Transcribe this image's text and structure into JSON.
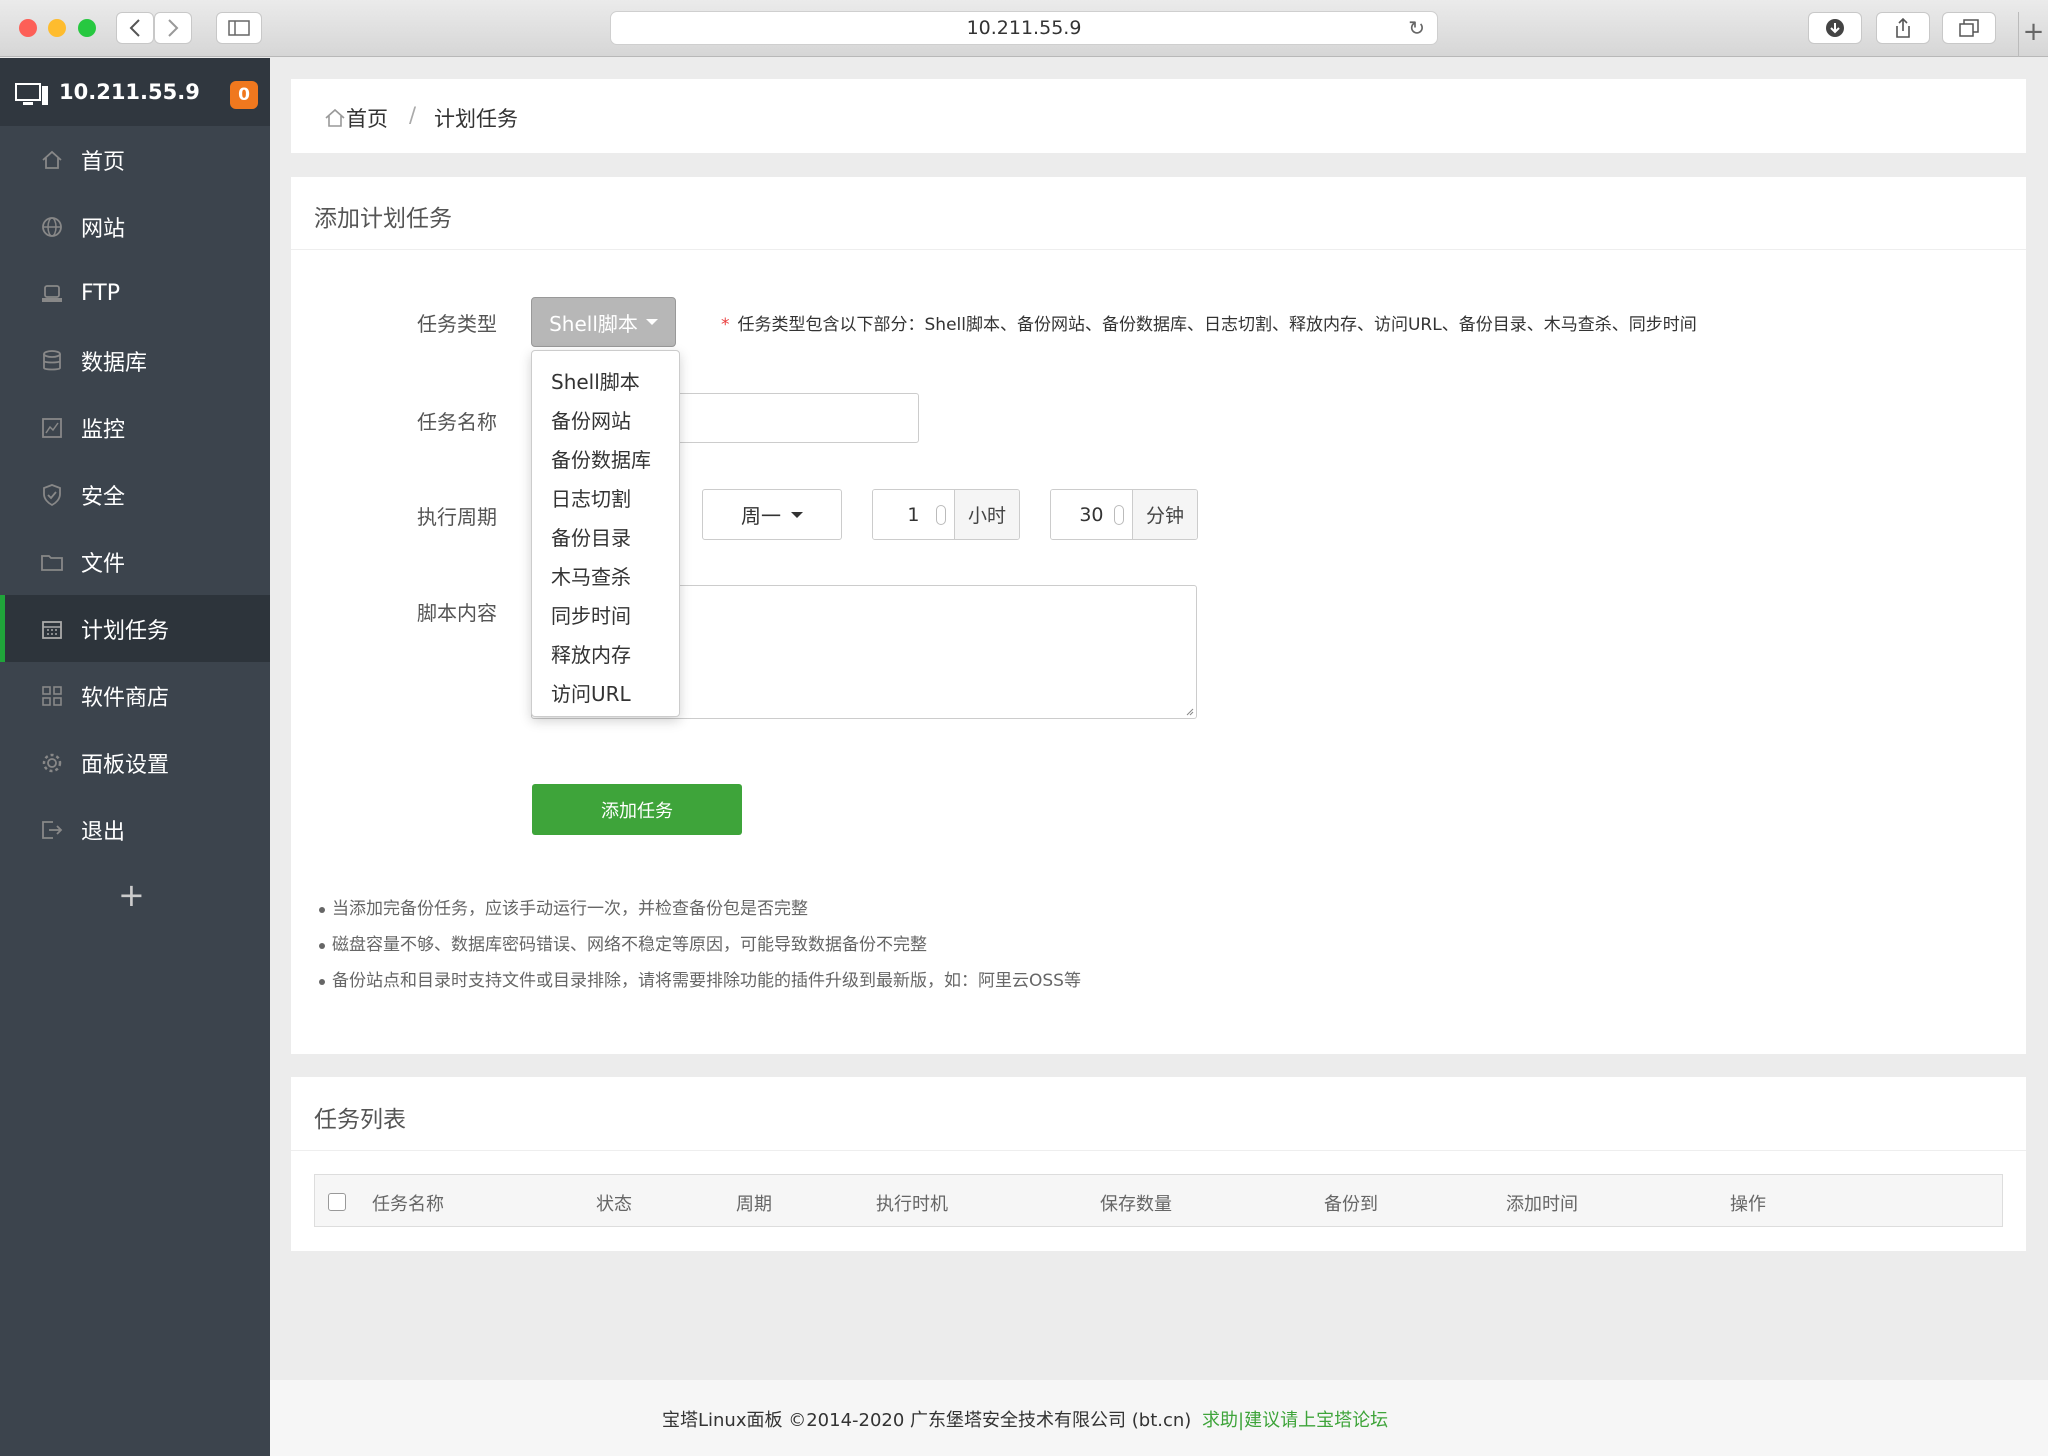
{
  "browser": {
    "url": "10.211.55.9"
  },
  "sidebar": {
    "server_ip": "10.211.55.9",
    "notification_count": "0",
    "items": [
      {
        "label": "首页",
        "icon": "home-icon"
      },
      {
        "label": "网站",
        "icon": "globe-icon"
      },
      {
        "label": "FTP",
        "icon": "ftp-icon"
      },
      {
        "label": "数据库",
        "icon": "database-icon"
      },
      {
        "label": "监控",
        "icon": "monitor-chart-icon"
      },
      {
        "label": "安全",
        "icon": "shield-icon"
      },
      {
        "label": "文件",
        "icon": "folder-icon"
      },
      {
        "label": "计划任务",
        "icon": "calendar-icon",
        "active": true
      },
      {
        "label": "软件商店",
        "icon": "grid-icon"
      },
      {
        "label": "面板设置",
        "icon": "gear-icon"
      },
      {
        "label": "退出",
        "icon": "logout-icon"
      }
    ],
    "add_label": "+"
  },
  "breadcrumb": {
    "home": "首页",
    "separator": "/",
    "current": "计划任务"
  },
  "add_task": {
    "title": "添加计划任务",
    "task_type_label": "任务类型",
    "task_type_value": "Shell脚本",
    "task_type_hint_star": "*",
    "task_type_hint": "任务类型包含以下部分：Shell脚本、备份网站、备份数据库、日志切割、释放内存、访问URL、备份目录、木马查杀、同步时间",
    "task_name_label": "任务名称",
    "task_name_value": "",
    "period_label": "执行周期",
    "weekday_value": "周一",
    "hour_value": "1",
    "hour_unit": "小时",
    "minute_value": "30",
    "minute_unit": "分钟",
    "script_label": "脚本内容",
    "submit_label": "添加任务",
    "notes": [
      "当添加完备份任务，应该手动运行一次，并检查备份包是否完整",
      "磁盘容量不够、数据库密码错误、网络不稳定等原因，可能导致数据备份不完整",
      "备份站点和目录时支持文件或目录排除，请将需要排除功能的插件升级到最新版，如：阿里云OSS等"
    ],
    "task_type_options": [
      "Shell脚本",
      "备份网站",
      "备份数据库",
      "日志切割",
      "备份目录",
      "木马查杀",
      "同步时间",
      "释放内存",
      "访问URL"
    ]
  },
  "task_list": {
    "title": "任务列表",
    "columns": [
      "任务名称",
      "状态",
      "周期",
      "执行时机",
      "保存数量",
      "备份到",
      "添加时间",
      "操作"
    ]
  },
  "footer": {
    "copyright": "宝塔Linux面板 ©2014-2020 广东堡塔安全技术有限公司 (bt.cn)",
    "forum_link": "求助|建议请上宝塔论坛"
  },
  "colors": {
    "accent": "#20a53a",
    "button_green": "#3ea43a",
    "sidebar_bg": "#3c444d",
    "badge": "#f0781e"
  }
}
